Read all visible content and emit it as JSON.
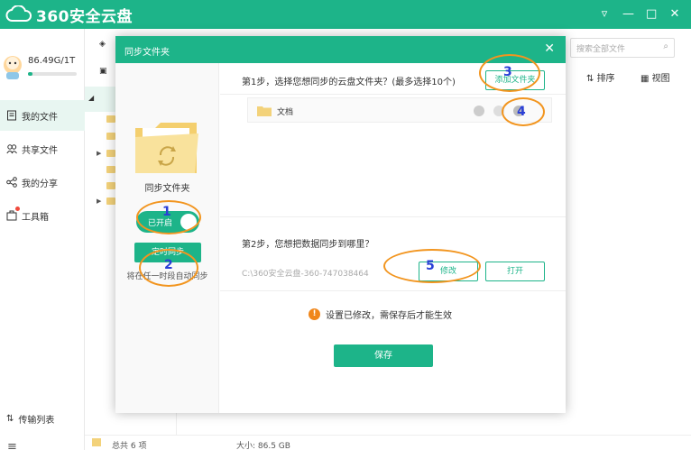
{
  "app": {
    "title": "360安全云盘"
  },
  "window_controls": [
    "▿",
    "—",
    "□",
    "✕"
  ],
  "sidebar": {
    "storage": "86.49G/1T",
    "storage_fraction": 0.0845,
    "items": [
      {
        "label": "我的文件",
        "icon": "file-list-icon",
        "active": true
      },
      {
        "label": "共享文件",
        "icon": "users-icon"
      },
      {
        "label": "我的分享",
        "icon": "share-icon"
      },
      {
        "label": "工具箱",
        "icon": "toolbox-icon"
      }
    ],
    "transfer": "传输列表",
    "menu_icon": "≡"
  },
  "main": {
    "search_placeholder": "搜索全部文件",
    "sort_label": "排序",
    "view_label": "视图",
    "status_count": "总共 6 项",
    "status_size": "大小: 86.5 GB"
  },
  "dialog": {
    "title": "同步文件夹",
    "left_title": "同步文件夹",
    "toggle_label": "已开启",
    "schedule_button": "定时同步",
    "schedule_desc": "将在任一时段自动同步",
    "step1": "第1步，选择您想同步的云盘文件夹？(最多选择10个)",
    "add_button": "添加文件夹",
    "folder_name": "文档",
    "step2": "第2步，您想把数据同步到哪里？",
    "local_path": "C:\\360安全云盘-360-747038464",
    "modify_button": "修改",
    "open_button": "打开",
    "notice": "设置已修改，需保存后才能生效",
    "save_button": "保存"
  },
  "annotations": [
    "1",
    "2",
    "3",
    "4",
    "5"
  ],
  "colors": {
    "brand": "#1db489",
    "annotation": "#f2951f",
    "annotation_number": "#2a3fd6",
    "warning": "#f0861a"
  }
}
